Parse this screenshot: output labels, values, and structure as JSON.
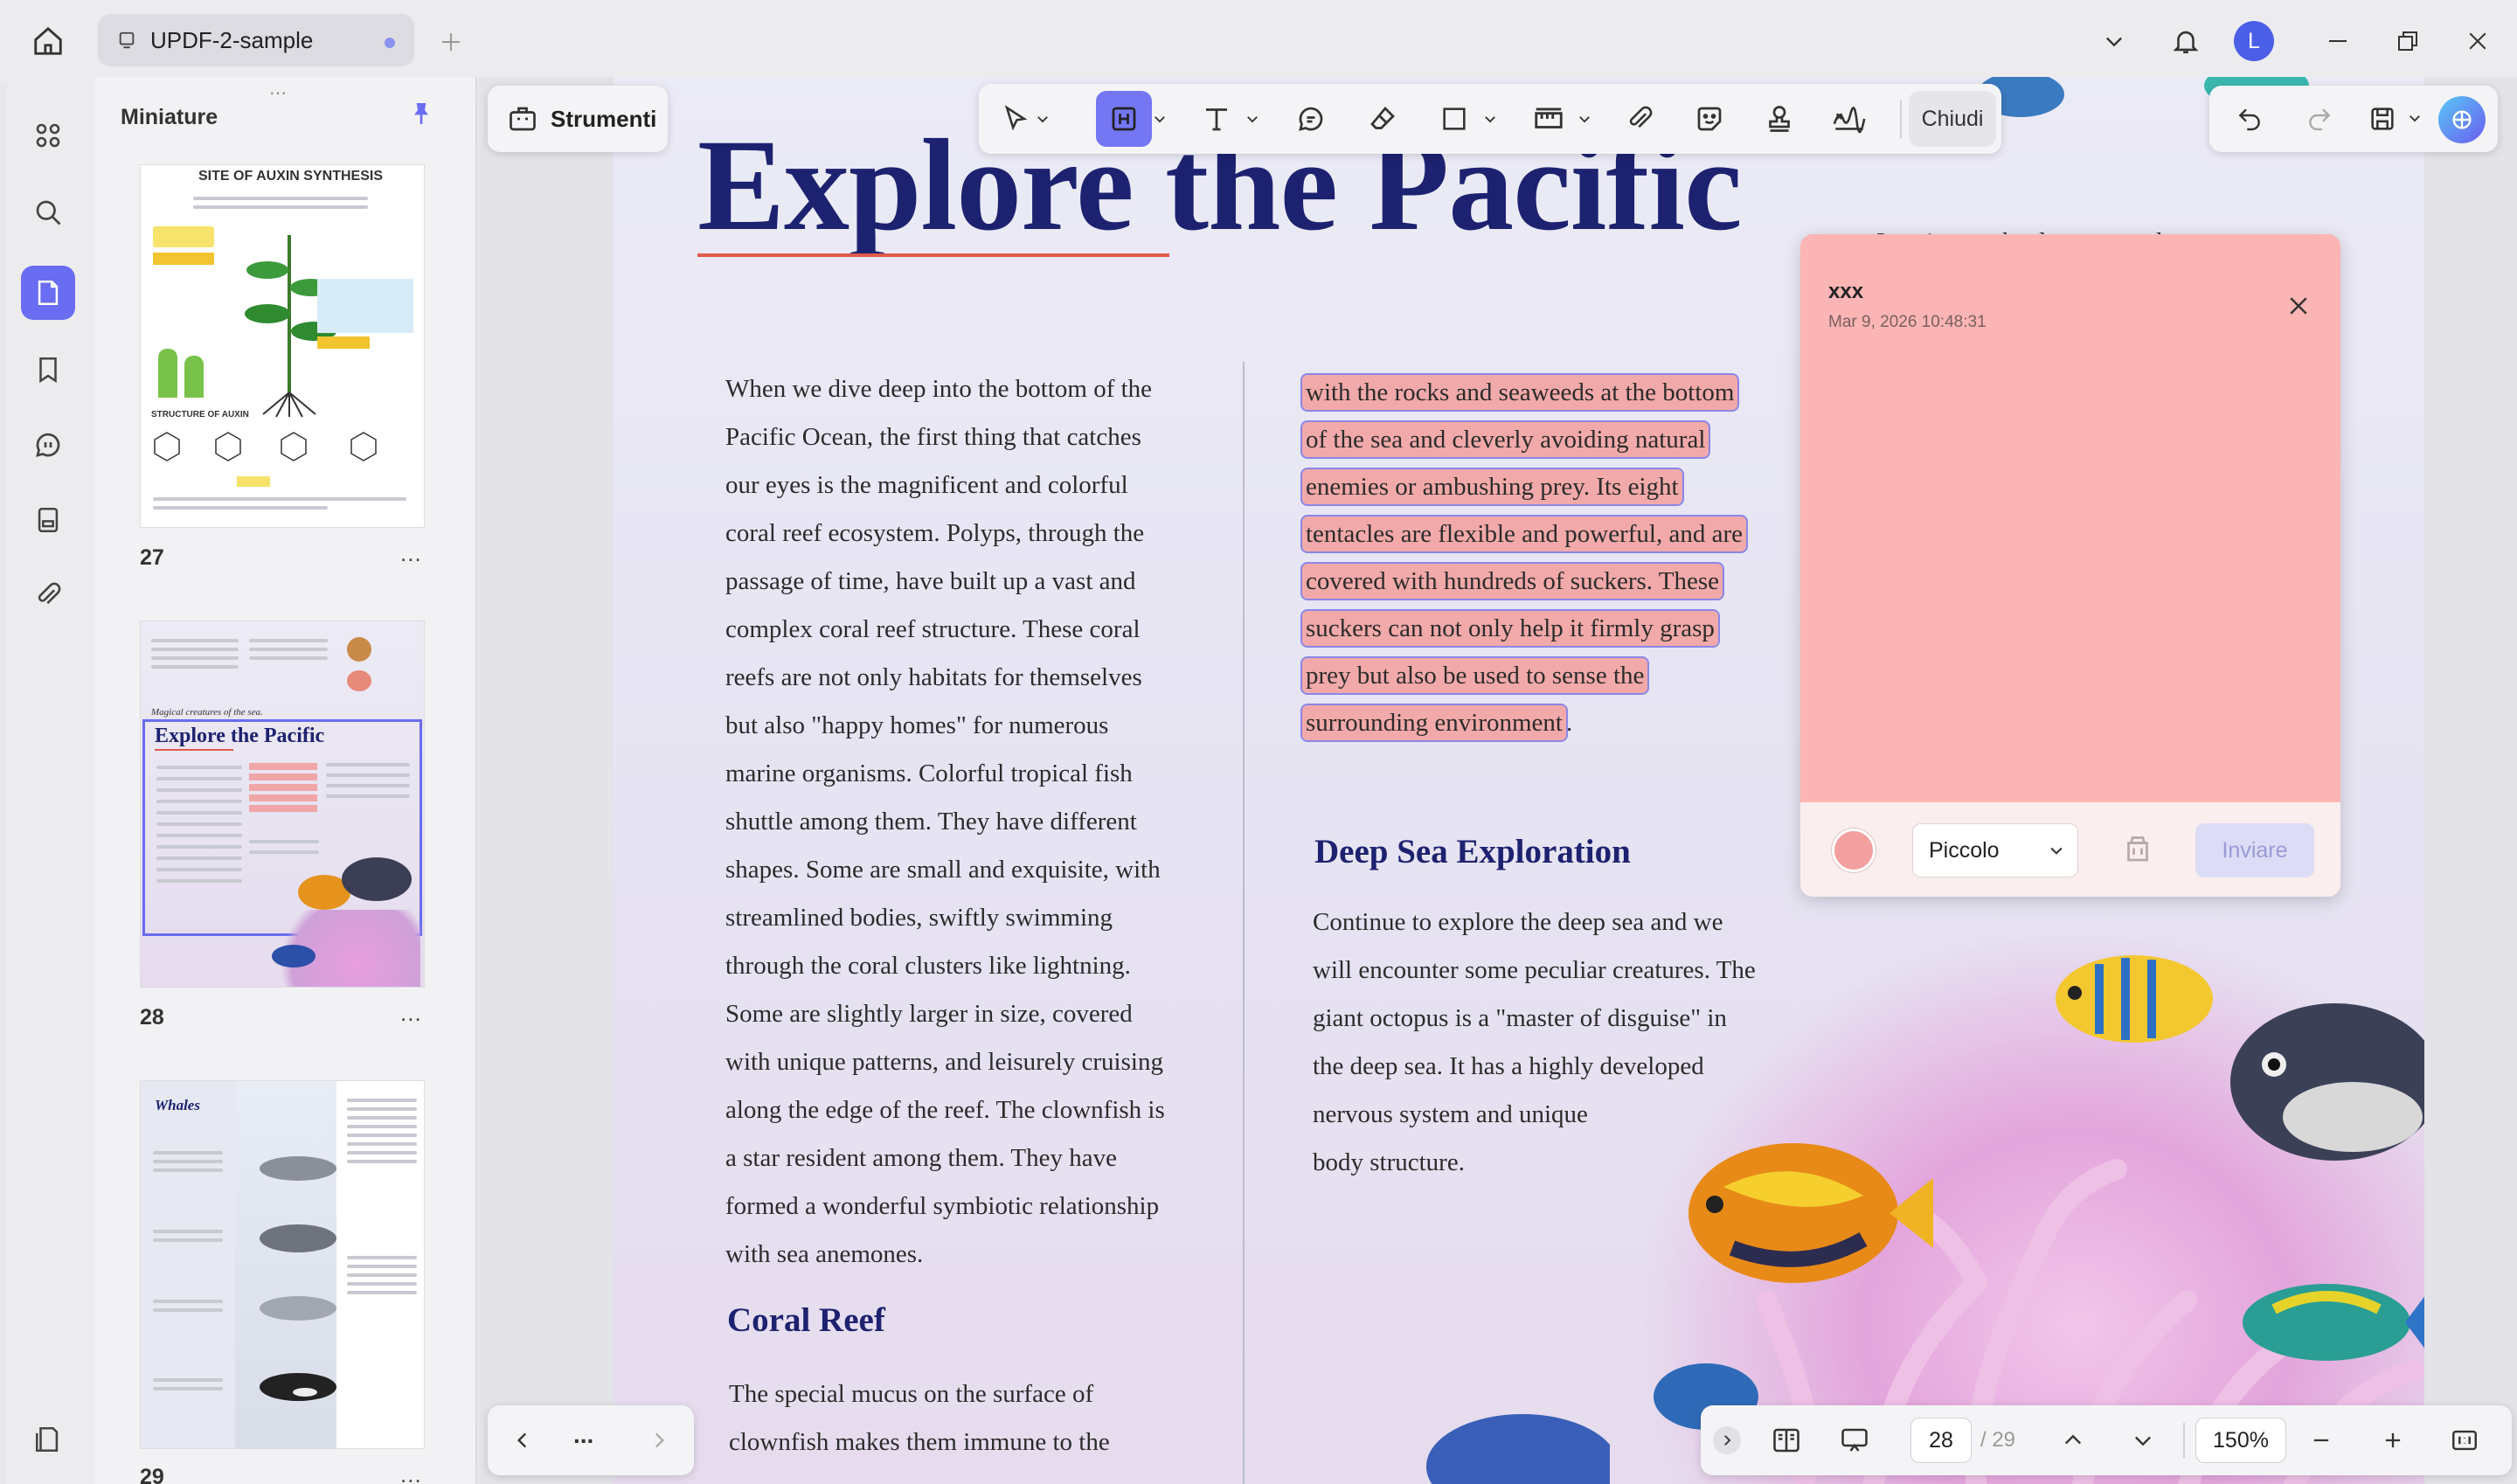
{
  "app": {
    "tab_title": "UPDF-2-sample",
    "avatar_initial": "L"
  },
  "sidebar": {
    "panel_title": "Miniature"
  },
  "thumbnails": [
    {
      "page": "27",
      "title": "SITE OF AUXIN SYNTHESIS",
      "sub": "STRUCTURE OF AUXIN"
    },
    {
      "page": "28",
      "title": "Explore the Pacific",
      "sub": "Magical creatures of the sea."
    },
    {
      "page": "29",
      "title": "Whales"
    }
  ],
  "thumbnail_more": "...",
  "toolbar": {
    "tools_label": "Strumenti",
    "close_label": "Chiudi"
  },
  "document": {
    "title": "Explore the Pacific",
    "col_right_top_fragment": "It swims to the deep sea and we",
    "col1": [
      "When we dive deep into the bottom of the",
      "Pacific Ocean, the first thing that catches",
      "our eyes is the magnificent and colorful",
      "coral reef ecosystem. Polyps, through the",
      "passage of time, have built up a vast and",
      "complex coral reef structure. These coral",
      "reefs are not only habitats for themselves",
      "but also \"happy homes\" for numerous",
      "marine organisms. Colorful tropical fish",
      "shuttle among them. They have different",
      "shapes. Some are small and exquisite, with",
      "streamlined bodies, swiftly swimming",
      "through the coral clusters like lightning.",
      "Some are slightly larger in size, covered",
      "with unique patterns, and leisurely cruising",
      "along the edge of the reef. The clownfish is",
      "a star resident among them. They have",
      "formed a wonderful symbiotic relationship",
      "with sea anemones."
    ],
    "coral_reef_heading": "Coral Reef",
    "coral_reef_text": [
      "The special mucus on the surface of",
      "clownfish makes them immune to the"
    ],
    "highlighted": [
      "with the rocks and seaweeds at the bottom",
      "of the sea and cleverly avoiding natural",
      "enemies or ambushing prey. Its eight",
      "tentacles are flexible and powerful, and are",
      "covered with hundreds of suckers. These",
      "suckers can not only help it firmly grasp",
      "prey but also be used to sense the",
      "surrounding environment"
    ],
    "highlight_end": ".",
    "deep_sea_heading": "Deep Sea Exploration",
    "deep_sea_text": [
      "Continue to explore the deep sea and we",
      "will encounter some peculiar creatures. The",
      "giant octopus is a \"master of disguise\" in",
      "the deep sea. It has a highly developed",
      "nervous system and unique",
      "body structure."
    ]
  },
  "note": {
    "author": "xxx",
    "date": "Mar 9, 2026 10:48:31",
    "size_label": "Piccolo",
    "send_label": "Inviare",
    "color": "#fbb5b4"
  },
  "pager": {
    "more": "..."
  },
  "page_nav": {
    "current": "28",
    "total": "/ 29",
    "zoom": "150%"
  },
  "colors": {
    "accent": "#6a6cf2",
    "heading": "#1d2270",
    "highlight": "#f2a9a9"
  }
}
